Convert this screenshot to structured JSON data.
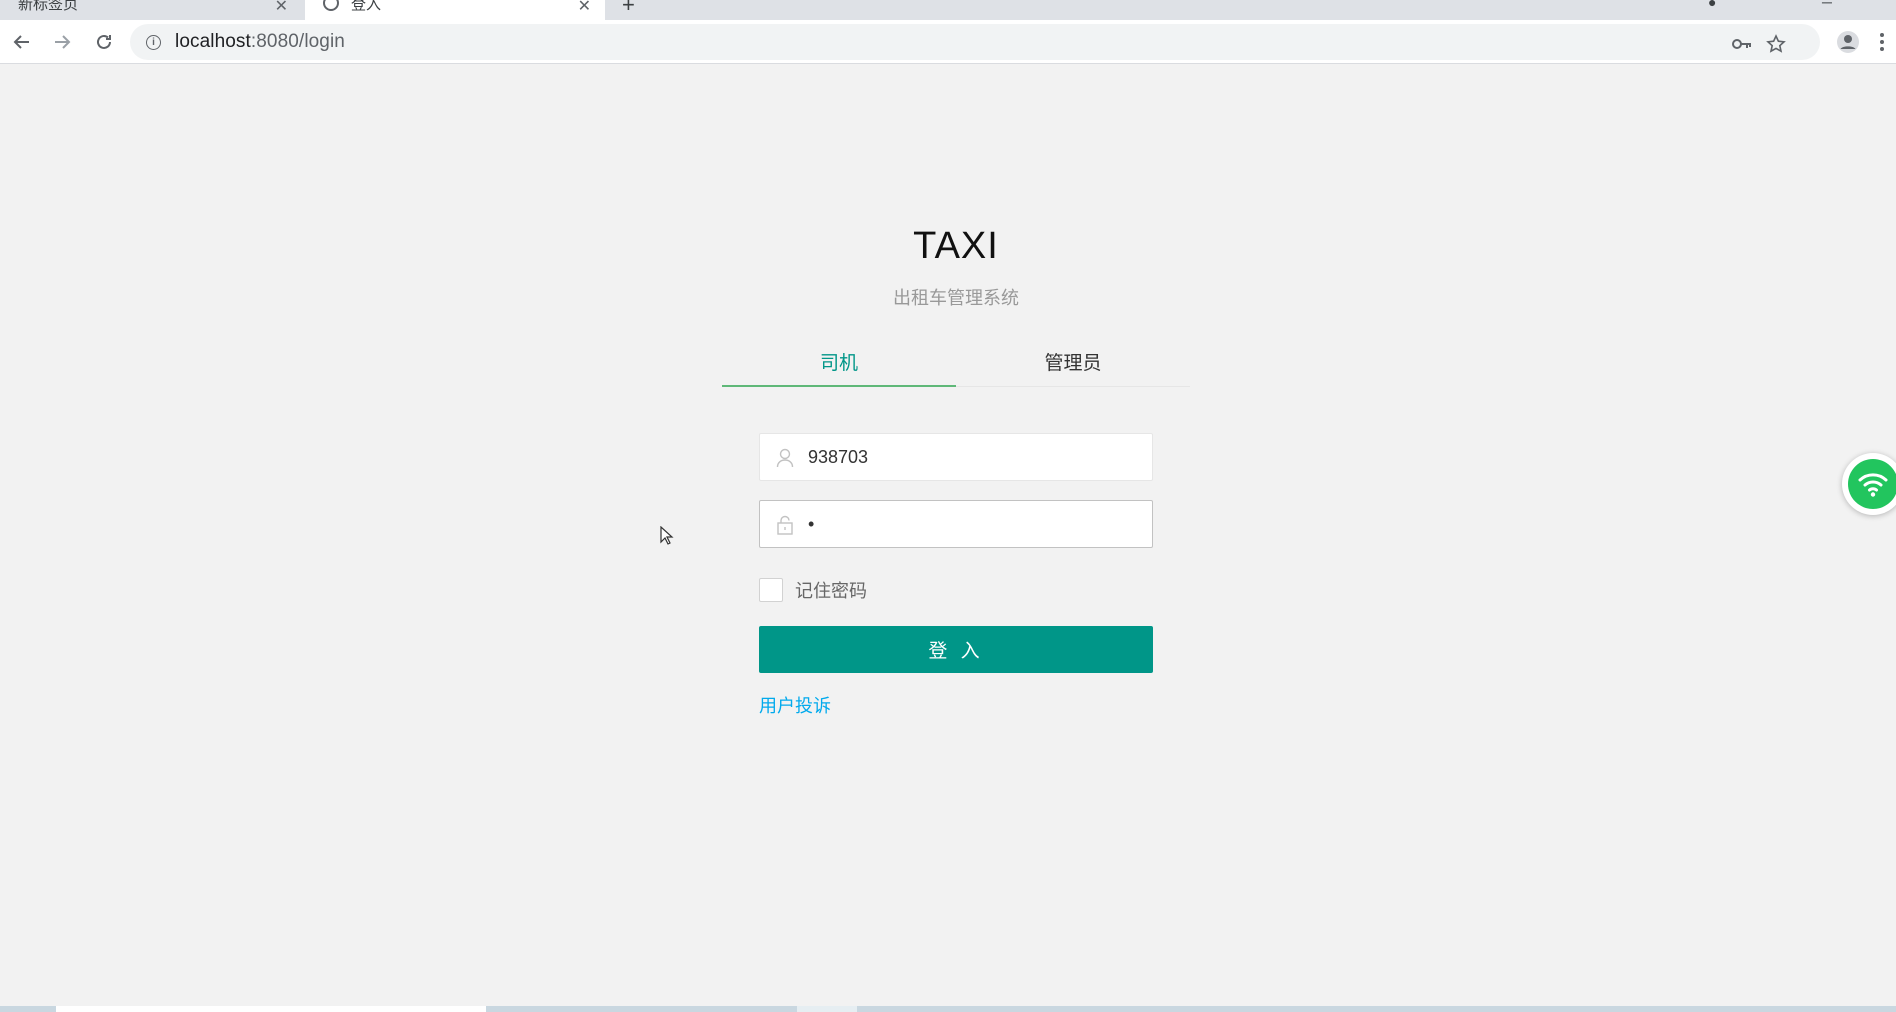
{
  "browser": {
    "tabs": [
      {
        "title": "新标签页"
      },
      {
        "title": "登入"
      }
    ],
    "new_tab_symbol": "+",
    "url_host": "localhost",
    "url_rest": ":8080/login",
    "icons": {
      "back": "arrow-left-icon",
      "forward": "arrow-right-icon",
      "reload": "reload-icon",
      "info": "info-icon",
      "key": "key-icon",
      "star": "star-icon",
      "profile": "profile-icon",
      "menu": "kebab-menu-icon"
    }
  },
  "page": {
    "title": "TAXI",
    "subtitle": "出租车管理系统",
    "tabs": [
      {
        "label": "司机",
        "active": true
      },
      {
        "label": "管理员",
        "active": false
      }
    ],
    "username": {
      "value": "938703",
      "icon": "user-icon"
    },
    "password": {
      "value": "•",
      "icon": "lock-icon"
    },
    "remember_label": "记住密码",
    "remember_checked": false,
    "login_button": "登 入",
    "complaint_link": "用户投诉",
    "colors": {
      "primary": "#009688",
      "tab_underline": "#5fb878",
      "link": "#01aaed",
      "background": "#f2f2f2"
    }
  }
}
